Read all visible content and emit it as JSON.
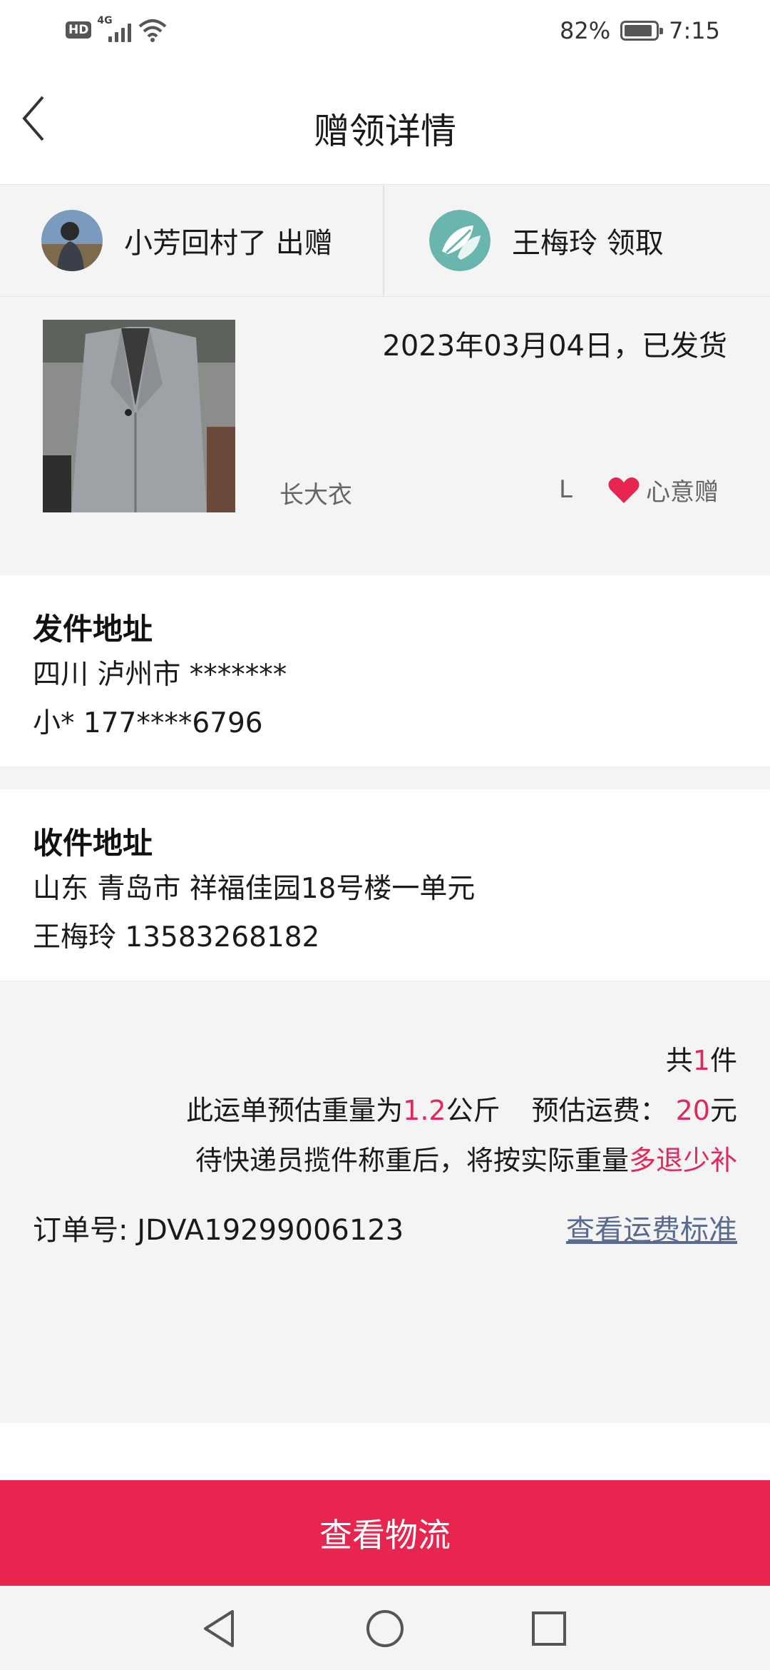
{
  "status_bar": {
    "hd": "HD",
    "network": "4G",
    "battery": "82%",
    "time": "7:15"
  },
  "header": {
    "title": "赠领详情",
    "back_icon": "chevron-left-icon"
  },
  "parties": {
    "giver": {
      "name": "小芳回村了 出赠"
    },
    "receiver": {
      "name": "王梅玲 领取"
    }
  },
  "item": {
    "status": "2023年03月04日，已发货",
    "name": "长大衣",
    "size": "L",
    "gift_type": "心意赠",
    "heart_color": "#e8254f"
  },
  "sender": {
    "heading": "发件地址",
    "address": "四川 泸州市 *******",
    "contact": "小* 177****6796"
  },
  "receiver_addr": {
    "heading": "收件地址",
    "address": "山东 青岛市 祥福佳园18号楼一单元",
    "contact": "王梅玲 13583268182"
  },
  "fee": {
    "count_prefix": "共",
    "count": "1",
    "count_suffix": "件",
    "weight_prefix": "此运单预估重量为",
    "weight": "1.2",
    "weight_unit": "公斤",
    "fee_label": "预估运费：",
    "fee_value": "20",
    "fee_unit": "元",
    "note_prefix": "待快递员揽件称重后，将按实际重量",
    "note_highlight": "多退少补",
    "order_label": "订单号:",
    "order_number": "JDVA19299006123",
    "standard_link": "查看运费标准"
  },
  "actions": {
    "view_logistics": "查看物流"
  },
  "colors": {
    "accent": "#e8254f",
    "highlight_red": "#e0285a",
    "link": "#5b6a8f"
  }
}
